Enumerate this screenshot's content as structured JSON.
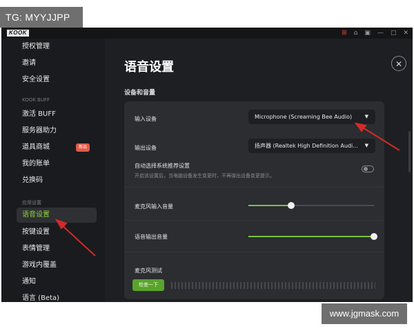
{
  "watermarks": {
    "top": "TG: MYYJJPP",
    "bottom": "www.jgmask.com"
  },
  "app": {
    "logo": "KOOK"
  },
  "titlebar": {
    "icons": [
      {
        "name": "gift-icon",
        "glyph": "⊞",
        "color": "#d64b3e"
      },
      {
        "name": "shop-icon",
        "glyph": "⌂"
      },
      {
        "name": "inbox-icon",
        "glyph": "▣"
      },
      {
        "name": "minimize-icon",
        "glyph": "—"
      },
      {
        "name": "maximize-icon",
        "glyph": "□"
      },
      {
        "name": "close-window-icon",
        "glyph": "✕"
      }
    ]
  },
  "sidebar": {
    "items": [
      {
        "label": "授权管理"
      },
      {
        "label": "邀请"
      },
      {
        "label": "安全设置"
      },
      {
        "label": "激活 BUFF"
      },
      {
        "label": "服务器助力"
      },
      {
        "label": "道具商城",
        "badge": "新品"
      },
      {
        "label": "我的账单"
      },
      {
        "label": "兑换码"
      },
      {
        "label": "语音设置",
        "active": true
      },
      {
        "label": "按键设置"
      },
      {
        "label": "表情管理"
      },
      {
        "label": "游戏内覆盖"
      },
      {
        "label": "通知"
      },
      {
        "label": "语言 (Beta)"
      }
    ],
    "group_kook_buff": "KOOK BUFF",
    "group_app_settings": "应用设置"
  },
  "main": {
    "title": "语音设置",
    "close_glyph": "✕",
    "section_title": "设备和音量",
    "input_device": {
      "label": "输入设备",
      "value": "Microphone (Screaming Bee Audio)",
      "arrow": "▼"
    },
    "output_device": {
      "label": "输出设备",
      "value": "扬声器 (Realtek High Definition Audi...",
      "arrow": "▼"
    },
    "auto_select": {
      "label": "自动选择系统推荐设置",
      "description": "开启该设置后，当电脑设备发生变更时，不再弹出设备变更提示。",
      "enabled": false
    },
    "mic_volume": {
      "label": "麦克风输入音量",
      "level": 0.34
    },
    "output_volume": {
      "label": "语音输出音量",
      "level": 1.0
    },
    "mic_test": {
      "label": "麦克风测试",
      "button": "检查一下"
    }
  },
  "colors": {
    "accent": "#7bc242",
    "button_green": "#5aa42c",
    "badge_red": "#e05a4a",
    "arrow_red": "#d42a2a"
  }
}
